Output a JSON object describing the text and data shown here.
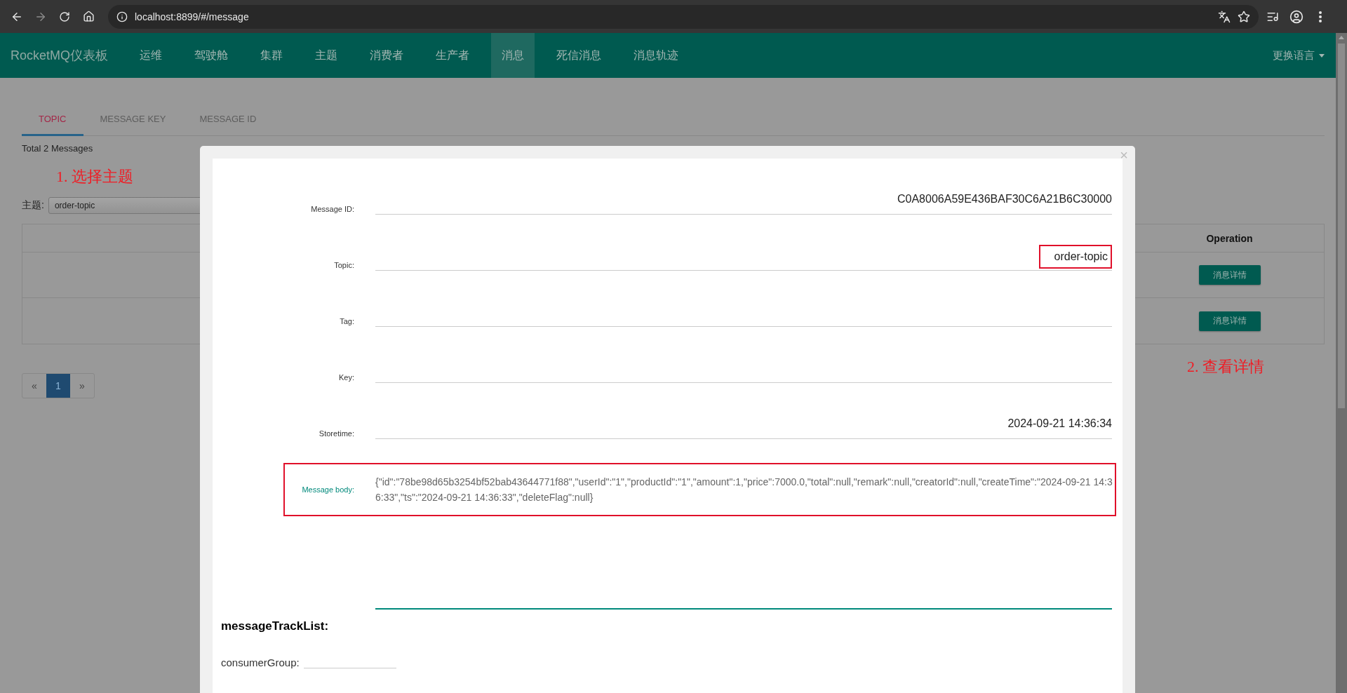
{
  "browser": {
    "url": "localhost:8899/#/message"
  },
  "navbar": {
    "brand": "RocketMQ仪表板",
    "items": [
      {
        "label": "运维",
        "selected": false
      },
      {
        "label": "驾驶舱",
        "selected": false
      },
      {
        "label": "集群",
        "selected": false
      },
      {
        "label": "主题",
        "selected": false
      },
      {
        "label": "消费者",
        "selected": false
      },
      {
        "label": "生产者",
        "selected": false
      },
      {
        "label": "消息",
        "selected": true
      },
      {
        "label": "死信消息",
        "selected": false
      },
      {
        "label": "消息轨迹",
        "selected": false
      }
    ],
    "language_menu": "更换语言"
  },
  "search_tabs": [
    {
      "label": "TOPIC",
      "selected": true
    },
    {
      "label": "MESSAGE KEY",
      "selected": false
    },
    {
      "label": "MESSAGE ID",
      "selected": false
    }
  ],
  "total": "Total 2 Messages",
  "annotations": [
    "1. 选择主题",
    "2. 查看详情"
  ],
  "topic_filter": {
    "label": "主题:",
    "value": "order-topic"
  },
  "table": {
    "columns": [
      {
        "label": "Operation"
      }
    ],
    "rows": [
      {
        "action": "消息详情"
      },
      {
        "action": "消息详情"
      }
    ]
  },
  "pagination": {
    "prev": "«",
    "pages": [
      {
        "label": "1",
        "selected": true
      }
    ],
    "next": "»"
  },
  "modal": {
    "close": "×",
    "fields": [
      {
        "label": "Message ID:",
        "value": "C0A8006A59E436BAF30C6A21B6C30000",
        "highlighted": false
      },
      {
        "label": "Topic:",
        "value": "order-topic",
        "highlighted": true
      },
      {
        "label": "Tag:",
        "highlighted": false
      },
      {
        "label": "Key:",
        "highlighted": false
      },
      {
        "label": "Storetime:",
        "value": "2024-09-21 14:36:34",
        "highlighted": false
      }
    ],
    "body": {
      "label": "Message body:",
      "value": "{\"id\":\"78be98d65b3254bf52bab43644771f88\",\"userId\":\"1\",\"productId\":\"1\",\"amount\":1,\"price\":7000.0,\"total\":null,\"remark\":null,\"creatorId\":null,\"createTime\":\"2024-09-21 14:36:33\",\"ts\":\"2024-09-21 14:36:33\",\"deleteFlag\":null}",
      "highlighted": true
    },
    "track_title": "messageTrackList:",
    "consumer_group_label": "consumerGroup:"
  }
}
